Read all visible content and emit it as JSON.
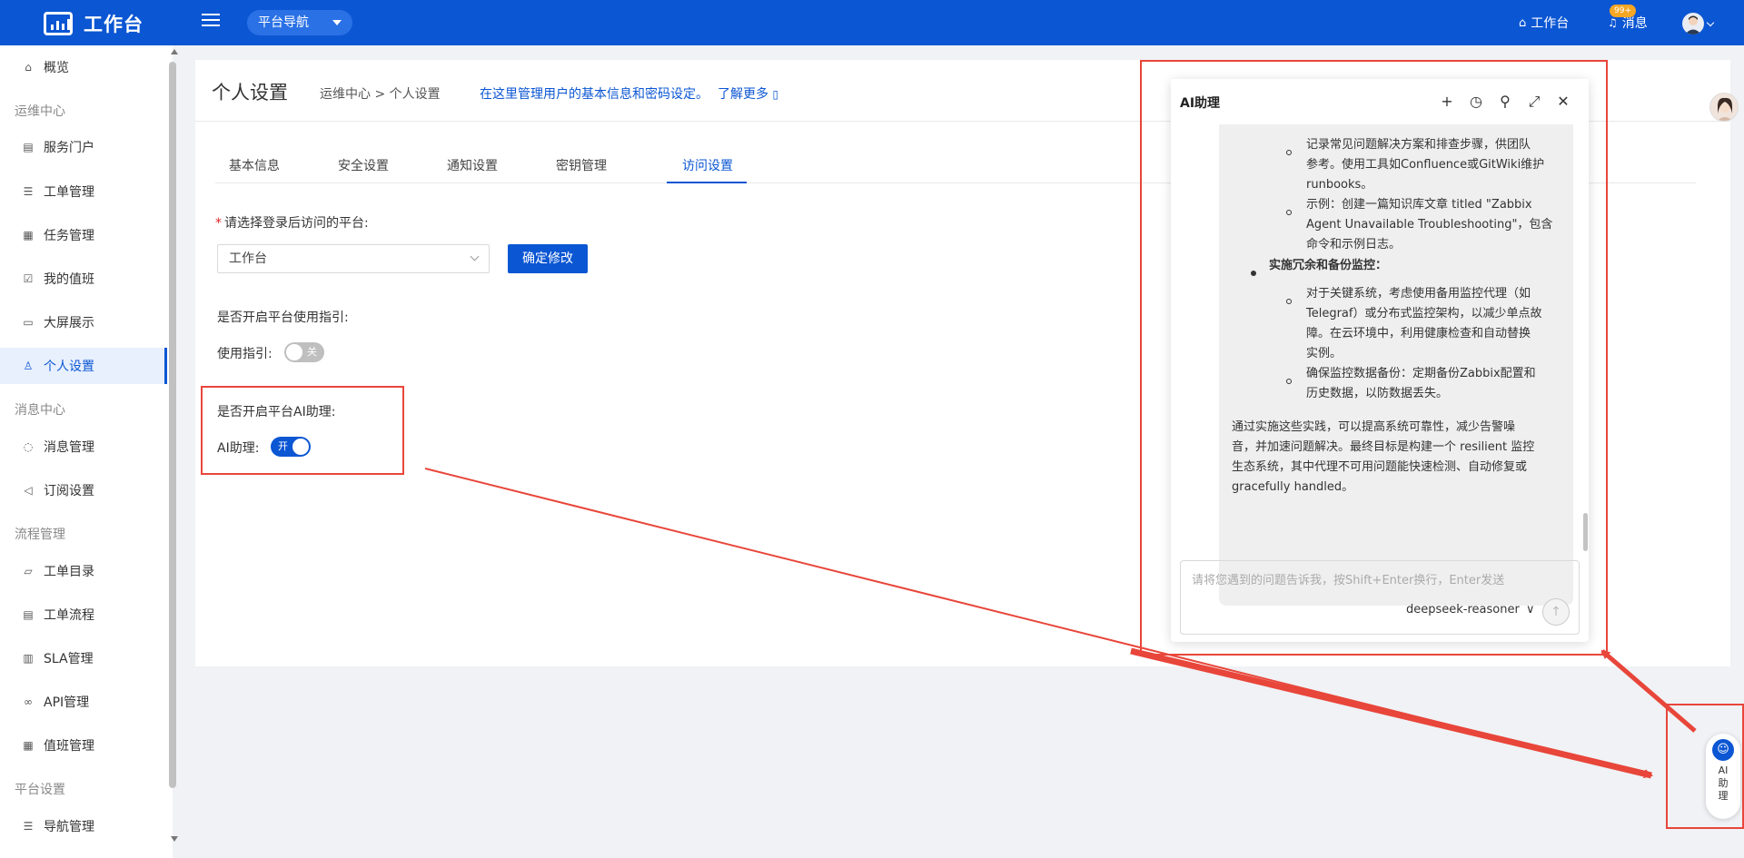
{
  "topbar": {
    "app_title": "工作台",
    "platform_nav": "平台导航",
    "workbench_link": "工作台",
    "messages_link": "消息",
    "messages_badge": "99+"
  },
  "sidebar": {
    "items": [
      {
        "label": "概览",
        "icon": "home-icon"
      },
      {
        "group": "运维中心"
      },
      {
        "label": "服务门户",
        "icon": "document-icon"
      },
      {
        "label": "工单管理",
        "icon": "list-icon"
      },
      {
        "label": "任务管理",
        "icon": "calendar-icon"
      },
      {
        "label": "我的值班",
        "icon": "check-calendar-icon"
      },
      {
        "label": "大屏展示",
        "icon": "monitor-icon"
      },
      {
        "label": "个人设置",
        "icon": "user-icon",
        "active": true
      },
      {
        "group": "消息中心"
      },
      {
        "label": "消息管理",
        "icon": "chat-icon"
      },
      {
        "label": "订阅设置",
        "icon": "megaphone-icon"
      },
      {
        "group": "流程管理"
      },
      {
        "label": "工单目录",
        "icon": "folder-icon"
      },
      {
        "label": "工单流程",
        "icon": "document-icon"
      },
      {
        "label": "SLA管理",
        "icon": "gauge-icon"
      },
      {
        "label": "API管理",
        "icon": "link-icon"
      },
      {
        "label": "值班管理",
        "icon": "calendar-icon"
      },
      {
        "group": "平台设置"
      },
      {
        "label": "导航管理",
        "icon": "list-icon"
      }
    ]
  },
  "page": {
    "title": "个人设置",
    "breadcrumb": "运维中心  >  个人设置",
    "description": "在这里管理用户的基本信息和密码设定。",
    "learn_more": "了解更多",
    "tabs": [
      "基本信息",
      "安全设置",
      "通知设置",
      "密钥管理",
      "访问设置"
    ],
    "active_tab": "访问设置",
    "platform_question": "请选择登录后访问的平台:",
    "platform_value": "工作台",
    "confirm_button": "确定修改",
    "guide_question": "是否开启平台使用指引:",
    "guide_label": "使用指引:",
    "guide_switch": "关",
    "ai_question": "是否开启平台AI助理:",
    "ai_label": "AI助理:",
    "ai_switch": "开"
  },
  "chat": {
    "title": "AI助理",
    "tools": [
      "plus-icon",
      "history-icon",
      "pin-icon",
      "expand-icon",
      "close-icon"
    ],
    "lines": [
      "记录常见问题解决方案和排查步骤，供团队",
      "参考。使用工具如Confluence或GitWiki维护",
      "runbooks。",
      "示例：创建一篇知识库文章 titled \"Zabbix",
      "Agent Unavailable Troubleshooting\"，包含",
      "命令和示例日志。",
      "实施冗余和备份监控：",
      "对于关键系统，考虑使用备用监控代理（如",
      "Telegraf）或分布式监控架构，以减少单点故",
      "障。在云环境中，利用健康检查和自动替换",
      "实例。",
      "确保监控数据备份：定期备份Zabbix配置和",
      "历史数据，以防数据丢失。",
      "通过实施这些实践，可以提高系统可靠性，减少告警噪",
      "音，并加速问题解决。最终目标是构建一个 resilient 监控",
      "生态系统，其中代理不可用问题能快速检测、自动修复或",
      "gracefully handled。"
    ],
    "input_placeholder": "请将您遇到的问题告诉我，按Shift+Enter换行，Enter发送",
    "model": "deepseek-reasoner"
  },
  "ai_float": {
    "label": "AI助理"
  },
  "colors": {
    "brand": "#0b56d3",
    "annotation": "#e8463a"
  }
}
